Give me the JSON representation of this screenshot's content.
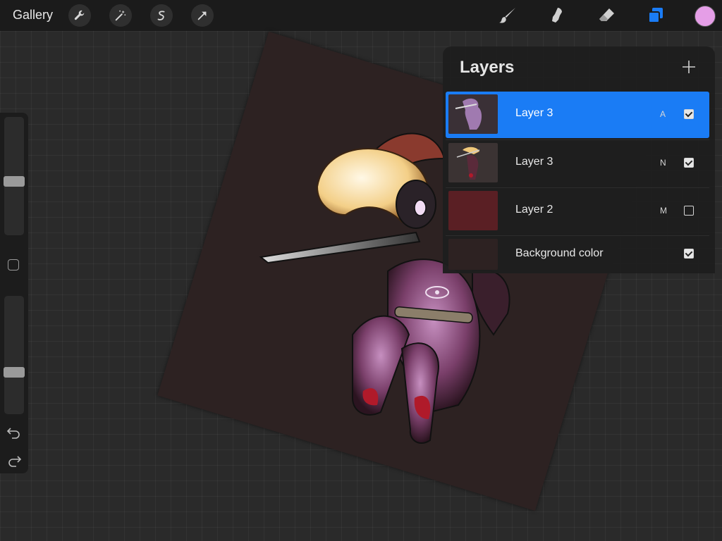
{
  "topbar": {
    "gallery_label": "Gallery",
    "left_tools": [
      "wrench-icon",
      "magic-wand-icon",
      "selection-icon",
      "transform-arrow-icon"
    ],
    "right_tools": [
      "brush-icon",
      "smudge-icon",
      "eraser-icon",
      "layers-icon"
    ],
    "active_color": "#e59ee7",
    "accent_color": "#1a7cf5"
  },
  "sidebar": {
    "brush_size_level": 0.55,
    "opacity_level": 0.66,
    "icons": [
      "modify-square-icon",
      "undo-icon",
      "redo-icon"
    ]
  },
  "layers_panel": {
    "title": "Layers",
    "add_icon": "plus-icon",
    "layers": [
      {
        "name": "Layer 3",
        "blend": "A",
        "visible": true,
        "selected": true
      },
      {
        "name": "Layer 3",
        "blend": "N",
        "visible": true,
        "selected": false
      },
      {
        "name": "Layer 2",
        "blend": "M",
        "visible": false,
        "selected": false
      },
      {
        "name": "Background color",
        "blend": "",
        "visible": true,
        "selected": false
      }
    ]
  }
}
